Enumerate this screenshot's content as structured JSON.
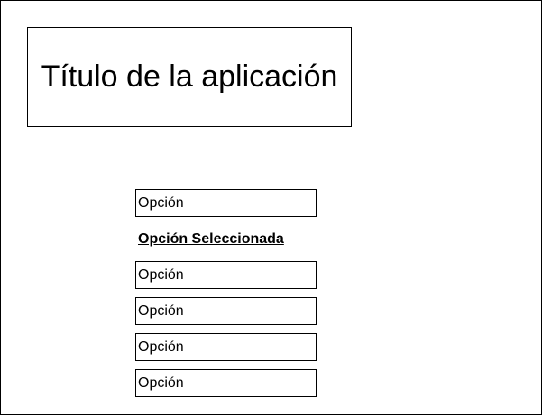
{
  "app": {
    "title": "Título de la aplicación"
  },
  "menu": {
    "items": [
      {
        "label": "Opción",
        "selected": false
      },
      {
        "label": "Opción Seleccionada",
        "selected": true
      },
      {
        "label": "Opción",
        "selected": false
      },
      {
        "label": "Opción",
        "selected": false
      },
      {
        "label": "Opción",
        "selected": false
      },
      {
        "label": "Opción",
        "selected": false
      }
    ]
  },
  "colors": {
    "border": "#000000",
    "background": "#ffffff",
    "text": "#000000"
  }
}
